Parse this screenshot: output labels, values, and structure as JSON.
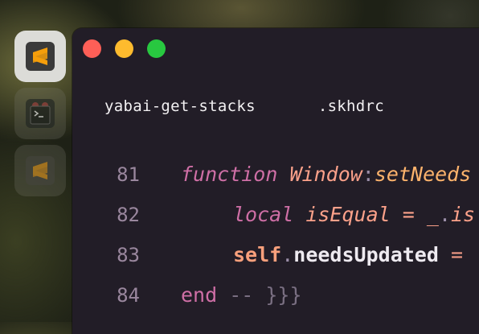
{
  "dock": {
    "items": [
      {
        "name": "sublime-text",
        "state": "active"
      },
      {
        "name": "terminal",
        "state": "inactive"
      },
      {
        "name": "sublime-text",
        "state": "inactive"
      }
    ]
  },
  "window": {
    "tabs": [
      "yabai-get-stacks",
      ".skhdrc"
    ],
    "code_lines": [
      {
        "number": "81",
        "tokens": [
          "function",
          "Window",
          ":",
          "setNeeds"
        ]
      },
      {
        "number": "82",
        "tokens": [
          "local",
          "isEqual",
          "=",
          "_",
          ".",
          "is"
        ]
      },
      {
        "number": "83",
        "tokens": [
          "self",
          ".",
          "needsUpdated",
          "="
        ]
      },
      {
        "number": "84",
        "tokens": [
          "end",
          "-- }}}"
        ]
      }
    ]
  },
  "colors": {
    "traffic_red": "#fe5f57",
    "traffic_yellow": "#febb2e",
    "traffic_green": "#28c840",
    "editor_bg": "#221d27",
    "keyword": "#cf6fa6",
    "function_name": "#fdb36c",
    "line_number": "#9a879e"
  }
}
